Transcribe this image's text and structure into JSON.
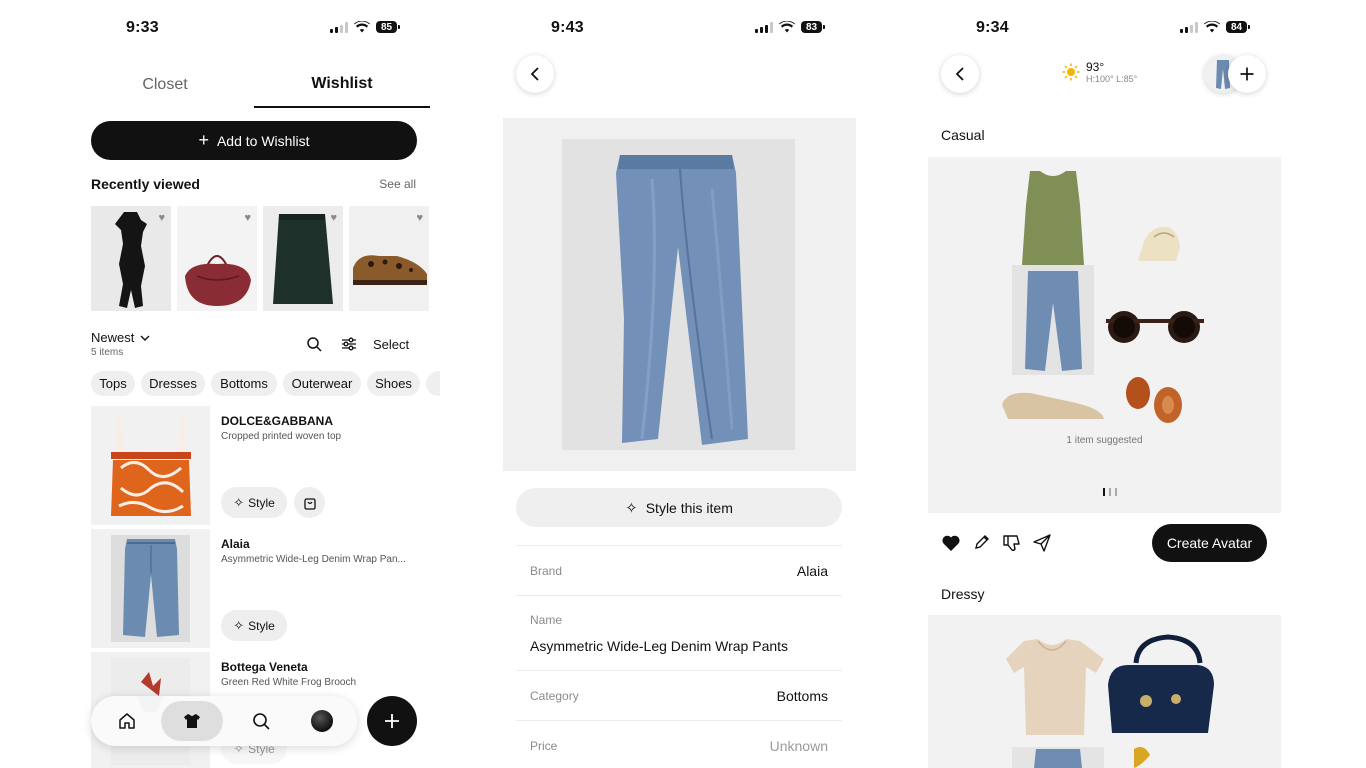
{
  "screen1": {
    "time": "9:33",
    "battery": "85",
    "tabs": [
      "Closet",
      "Wishlist"
    ],
    "add_button": "Add to Wishlist",
    "recently_viewed": {
      "title": "Recently viewed",
      "see_all": "See all"
    },
    "sort": {
      "label": "Newest",
      "count": "5 items",
      "select": "Select"
    },
    "chips": [
      "Tops",
      "Dresses",
      "Bottoms",
      "Outerwear",
      "Shoes"
    ],
    "items": [
      {
        "brand": "DOLCE&GABBANA",
        "desc": "Cropped printed woven top",
        "style": "Style"
      },
      {
        "brand": "Alaia",
        "desc": "Asymmetric Wide-Leg Denim Wrap Pan...",
        "style": "Style"
      },
      {
        "brand": "Bottega Veneta",
        "desc": "Green Red White Frog Brooch",
        "style": "Style"
      }
    ]
  },
  "screen2": {
    "time": "9:43",
    "battery": "83",
    "style_button": "Style this item",
    "details": {
      "brand_label": "Brand",
      "brand_value": "Alaia",
      "name_label": "Name",
      "name_value": "Asymmetric Wide-Leg Denim Wrap Pants",
      "category_label": "Category",
      "category_value": "Bottoms",
      "price_label": "Price",
      "price_value": "Unknown"
    }
  },
  "screen3": {
    "time": "9:34",
    "battery": "84",
    "weather": {
      "temp": "93°",
      "range": "H:100° L:85°"
    },
    "sections": [
      "Casual",
      "Dressy"
    ],
    "suggested": "1 item suggested",
    "create_avatar": "Create Avatar"
  },
  "colors": {
    "accent": "#111111",
    "panel": "#f2f2f2",
    "chip": "#efefef"
  }
}
